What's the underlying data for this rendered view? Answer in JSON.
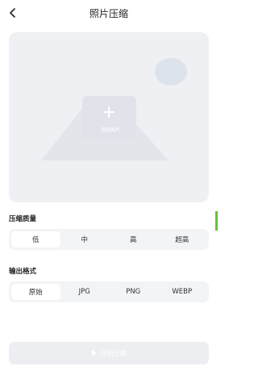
{
  "header": {
    "title": "照片压缩",
    "back_icon": "chevron-left-icon"
  },
  "preview": {
    "upload_label": "添加图片",
    "upload_icon": "plus-icon",
    "placeholder_icon": "image-placeholder-icon"
  },
  "quality": {
    "label": "压缩质量",
    "options": [
      "低",
      "中",
      "高",
      "超高"
    ],
    "selected": "低"
  },
  "format": {
    "label": "输出格式",
    "options": [
      "原始",
      "JPG",
      "PNG",
      "WEBP"
    ],
    "selected": "原始"
  },
  "action": {
    "start_label": "开始压缩",
    "start_icon": "play-icon"
  },
  "colors": {
    "background": "#ffffff",
    "card": "#eef0f3",
    "segment_bg": "#f3f4f6",
    "button_disabled": "#eceef1"
  }
}
